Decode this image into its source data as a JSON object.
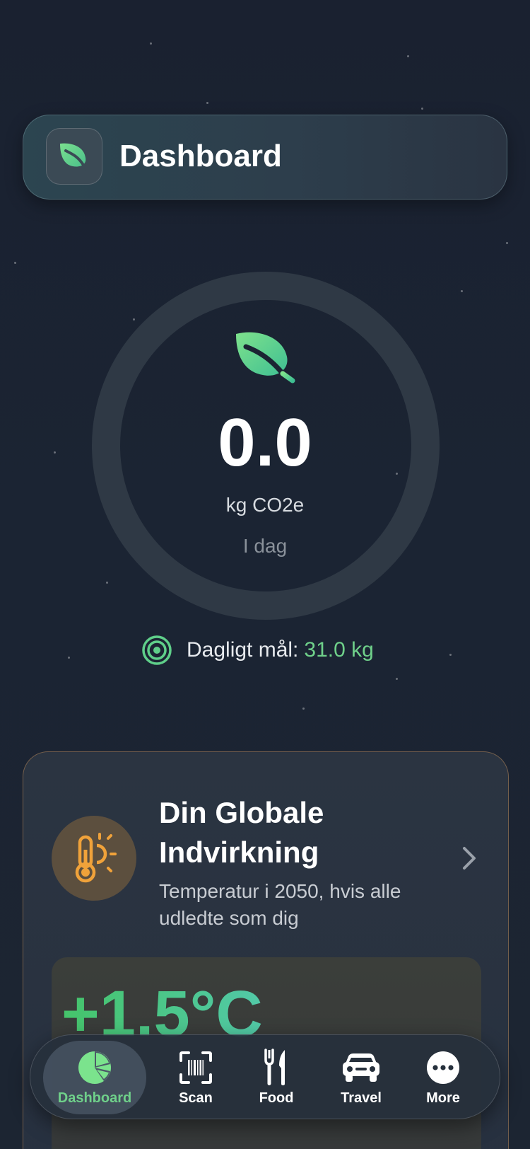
{
  "header": {
    "title": "Dashboard",
    "icon": "leaf-icon"
  },
  "emissions": {
    "value": "0.0",
    "unit": "kg CO2e",
    "period": "I dag",
    "icon": "leaf-icon",
    "progress": 0
  },
  "goal": {
    "label": "Dagligt mål:",
    "value": "31.0 kg",
    "icon": "target-icon"
  },
  "impact_card": {
    "title": "Din Globale Indvirkning",
    "subtitle": "Temperatur i 2050, hvis alle udledte som dig",
    "temperature": "+1.5°C",
    "icon": "thermometer-sun-icon"
  },
  "tabs": [
    {
      "label": "Dashboard",
      "icon": "pie-chart-icon",
      "active": true
    },
    {
      "label": "Scan",
      "icon": "barcode-scan-icon",
      "active": false
    },
    {
      "label": "Food",
      "icon": "fork-knife-icon",
      "active": false
    },
    {
      "label": "Travel",
      "icon": "car-icon",
      "active": false
    },
    {
      "label": "More",
      "icon": "more-dots-icon",
      "active": false
    }
  ],
  "colors": {
    "accent": "#6fd08a",
    "background": "#1b2433",
    "card_border": "#d2965a",
    "thermometer": "#f0a23a"
  }
}
